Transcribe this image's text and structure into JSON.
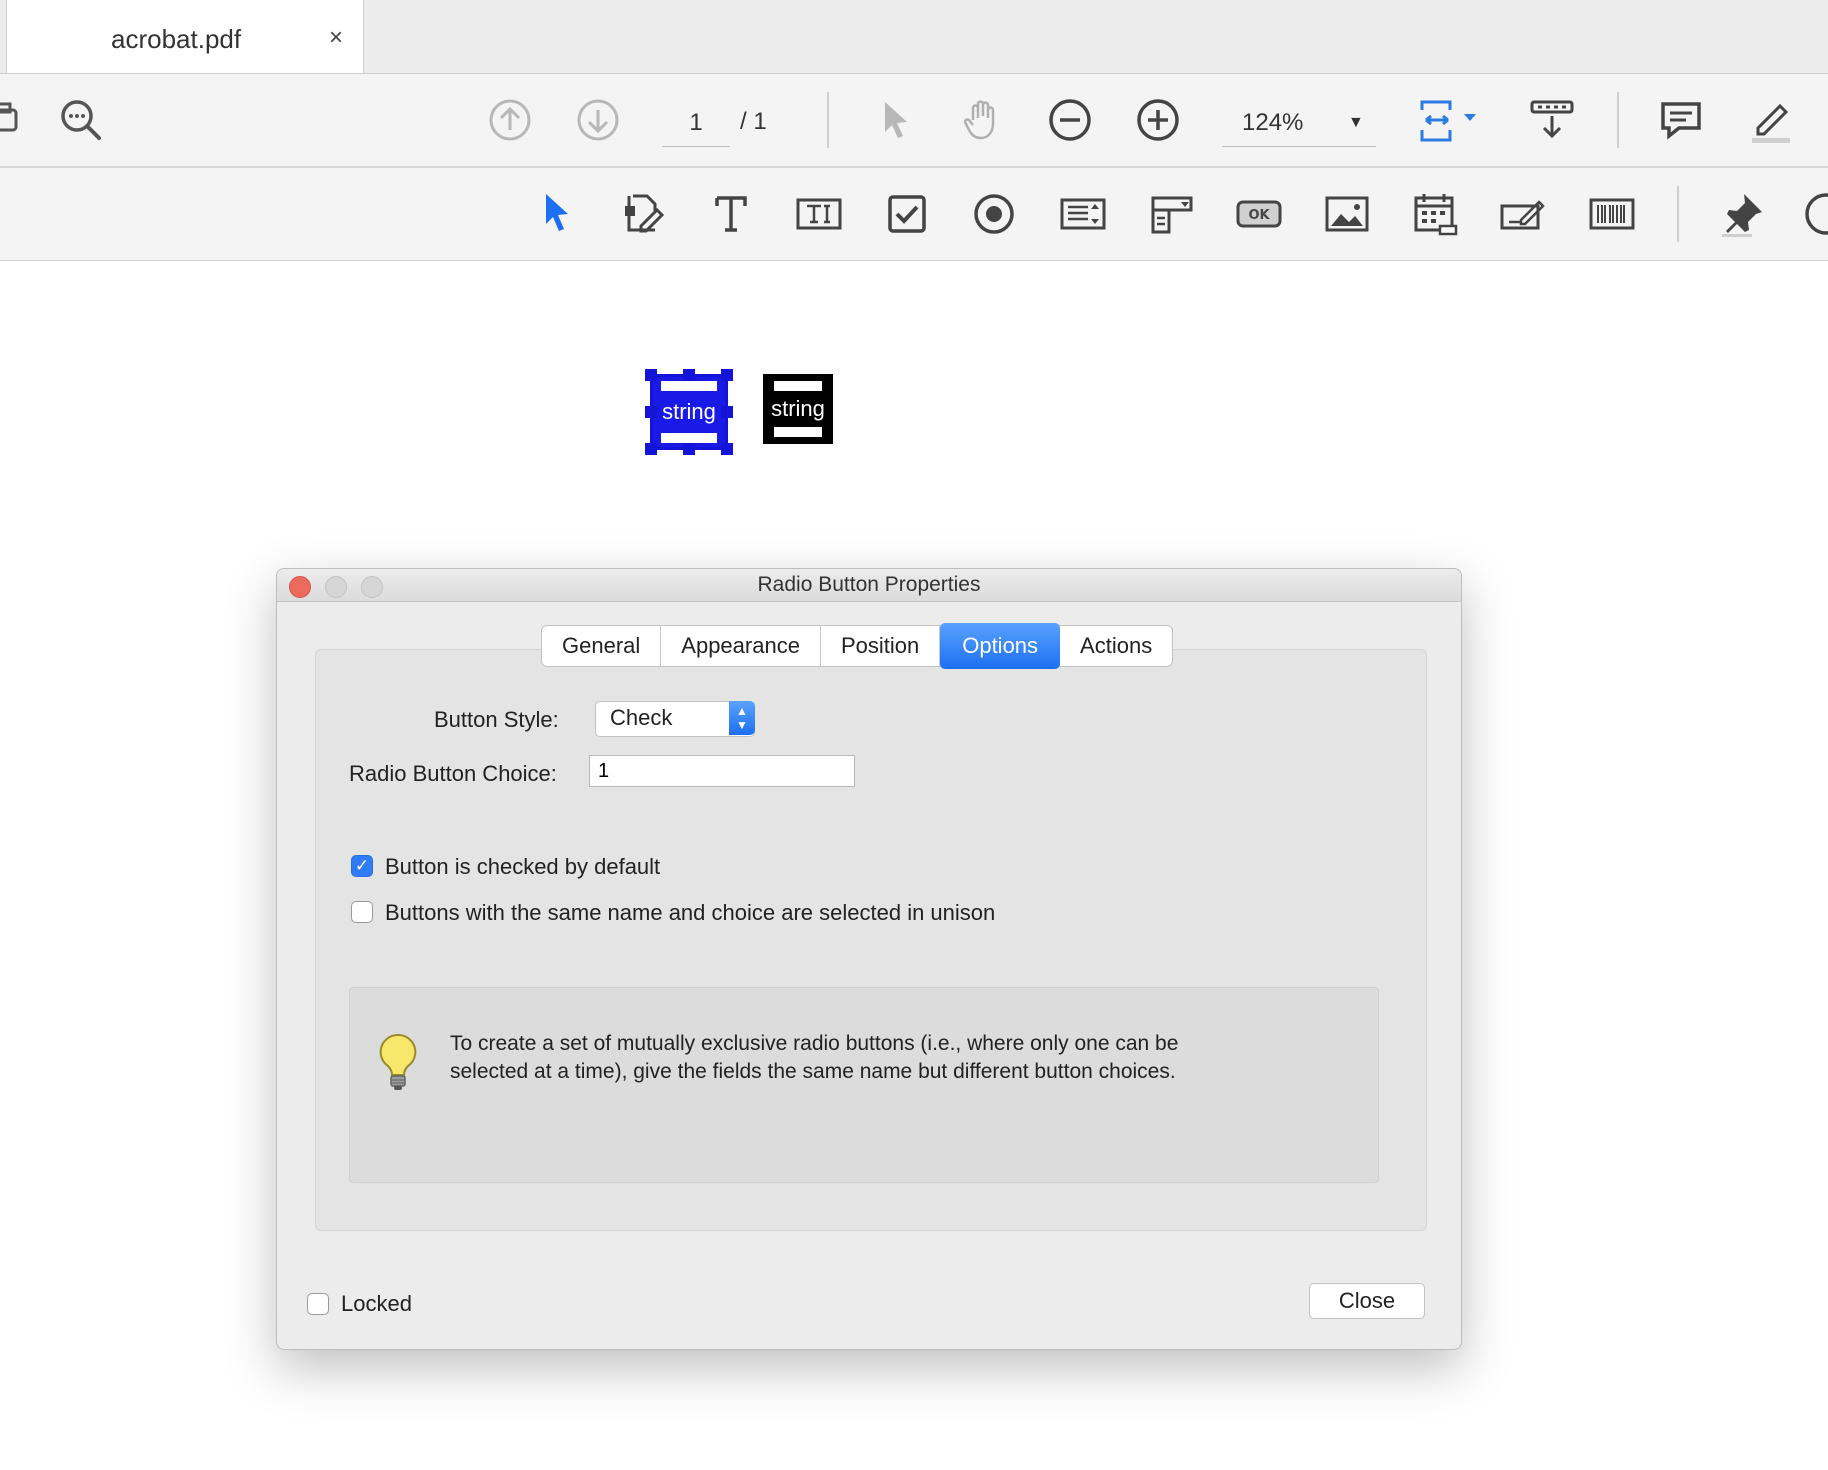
{
  "tab": {
    "title": "acrobat.pdf",
    "close_glyph": "×"
  },
  "toolbar1": {
    "icons": [
      "print-icon",
      "search-icon",
      "page-up-icon",
      "page-down-icon",
      "select-arrow-icon",
      "hand-icon",
      "zoom-out-icon",
      "zoom-in-icon",
      "fit-page-icon",
      "scroll-mode-icon",
      "comment-icon",
      "highlight-icon"
    ],
    "page_current": "1",
    "page_total": "/ 1",
    "zoom": "124%"
  },
  "toolbar2": {
    "icons": [
      "select-object-icon",
      "edit-form-icon",
      "text-icon",
      "text-field-icon",
      "checkbox-icon",
      "radio-button-icon",
      "list-box-icon",
      "dropdown-icon",
      "button-icon",
      "image-icon",
      "date-field-icon",
      "signature-icon",
      "barcode-icon",
      "pin-icon",
      "help-icon"
    ]
  },
  "page": {
    "field_selected_label": "string",
    "field_plain_label": "string"
  },
  "dialog": {
    "title": "Radio Button Properties",
    "tabs": [
      "General",
      "Appearance",
      "Position",
      "Options",
      "Actions"
    ],
    "active_tab": "Options",
    "button_style_label": "Button Style:",
    "button_style_value": "Check",
    "choice_label": "Radio Button Choice:",
    "choice_value": "1",
    "checked_default_label": "Button is checked by default",
    "checked_default": true,
    "unison_label": "Buttons with the same name and choice are selected in unison",
    "unison": false,
    "tip_line1": "To create a set of mutually exclusive radio buttons (i.e., where only one can be",
    "tip_line2": "selected at a time), give the fields the same name but different button choices.",
    "locked_label": "Locked",
    "locked": false,
    "close_label": "Close"
  },
  "colors": {
    "accent": "#1d6ff2",
    "selection": "#1414d8",
    "close_traffic": "#ed6a5e"
  }
}
